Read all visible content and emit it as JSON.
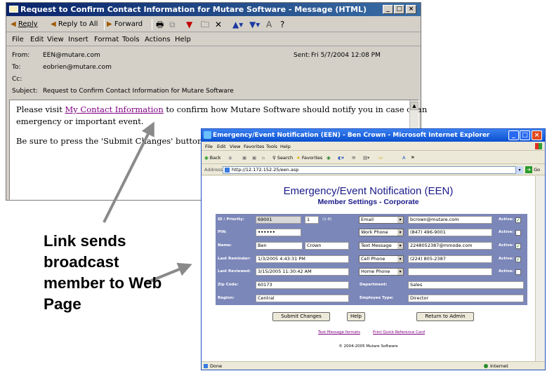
{
  "outlook": {
    "title": "Request to Confirm Contact Information for Mutare Software - Message (HTML)",
    "toolbar": {
      "reply": "Reply",
      "reply_all": "Reply to All",
      "forward": "Forward"
    },
    "menu": [
      "File",
      "Edit",
      "View",
      "Insert",
      "Format",
      "Tools",
      "Actions",
      "Help"
    ],
    "header": {
      "from_label": "From:",
      "from": "EEN@mutare.com",
      "sent_label": "Sent:",
      "sent": "Fri 5/7/2004 12:08 PM",
      "to_label": "To:",
      "to": "eobrien@mutare.com",
      "cc_label": "Cc:",
      "subject_label": "Subject:",
      "subject": "Request to Confirm Contact Information for Mutare Software"
    },
    "body": {
      "p1_pre": "Please visit ",
      "link": "My Contact Information",
      "p1_post": " to confirm how Mutare Software should notify you in case of an",
      "p1_line2": "emergency or important event.",
      "p2": "Be sure to press the 'Submit Changes' button even"
    }
  },
  "browser": {
    "title": "Emergency/Event Notification (EEN) - Ben Crown - Microsoft Internet Explorer",
    "menu": [
      "File",
      "Edit",
      "View",
      "Favorites",
      "Tools",
      "Help"
    ],
    "toolbar": {
      "back": "Back",
      "search": "Search",
      "favorites": "Favorites"
    },
    "address_label": "Address",
    "address": "http://12.172.152.25/een.asp",
    "go": "Go",
    "page": {
      "title": "Emergency/Event Notification (EEN)",
      "subtitle": "Member Settings - Corporate",
      "labels": {
        "id_priority": "ID / Priority:",
        "pin": "PIN:",
        "name": "Name:",
        "last_reminder": "Last Reminder:",
        "last_reviewed": "Last Reviewed:",
        "zip": "Zip Code:",
        "region": "Region:",
        "department": "Department:",
        "employee_type": "Employee Type:",
        "active": "Active:"
      },
      "values": {
        "id": "69001",
        "priority": "1",
        "priority_range": "(1-8)",
        "pin": "••••••",
        "first_name": "Ben",
        "last_name": "Crown",
        "last_reminder": "1/3/2005 4:43:31 PM",
        "last_reviewed": "3/15/2005 11:30:42 AM",
        "zip": "60173",
        "region": "Central",
        "department": "Sales",
        "employee_type": "Director"
      },
      "devices": [
        {
          "type": "Email",
          "value": "bcrown@mutare.com",
          "active": true
        },
        {
          "type": "Work Phone",
          "value": "(847) 496-9001",
          "active": false
        },
        {
          "type": "Text Message",
          "value": "2248052387@mmode.com",
          "active": true
        },
        {
          "type": "Cell Phone",
          "value": "(224) 805-2387",
          "active": true
        },
        {
          "type": "Home Phone",
          "value": "",
          "active": false
        }
      ],
      "buttons": {
        "submit": "Submit Changes",
        "help": "Help",
        "return": "Return to Admin"
      },
      "links": {
        "text_formats": "Text Message formats",
        "quick_ref": "Print Quick Reference Card"
      },
      "copyright": "© 2004-2005 Mutare Software"
    },
    "status": {
      "left": "Done",
      "right": "Internet"
    }
  },
  "annotation": {
    "lines": [
      "Link sends",
      "broadcast",
      "member to Web",
      "Page"
    ]
  }
}
